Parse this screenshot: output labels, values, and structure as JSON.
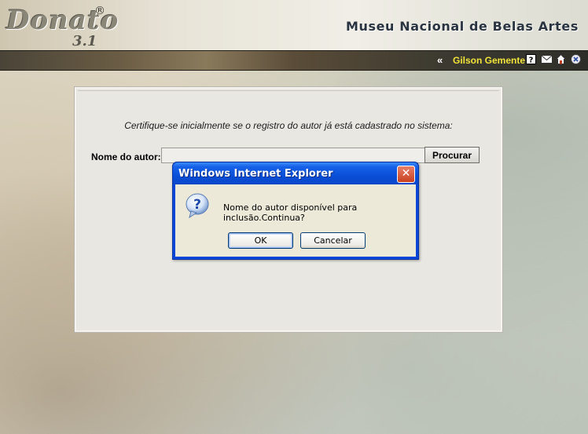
{
  "header": {
    "logo_text": "Donato",
    "logo_version": "3.1",
    "logo_registered": "®",
    "museum_title": "Museu Nacional de Belas Artes"
  },
  "toolbar": {
    "back_symbol": "«",
    "user_name": "Gilson Gemente",
    "icons": [
      "help-icon",
      "mail-icon",
      "home-icon",
      "exit-icon"
    ]
  },
  "form": {
    "instruction": "Certifique-se inicialmente se o registro do autor já está cadastrado no sistema:",
    "author_label": "Nome do autor:",
    "author_value": "",
    "search_button": "Procurar"
  },
  "dialog": {
    "title": "Windows Internet Explorer",
    "close_symbol": "✕",
    "message": "Nome do autor disponível para inclusão.Continua?",
    "ok_label": "OK",
    "cancel_label": "Cancelar",
    "icon": "question-icon"
  },
  "colors": {
    "user_name": "#f2e43a",
    "dialog_titlebar": "#0a4fd8",
    "dialog_body": "#ece9d8"
  }
}
